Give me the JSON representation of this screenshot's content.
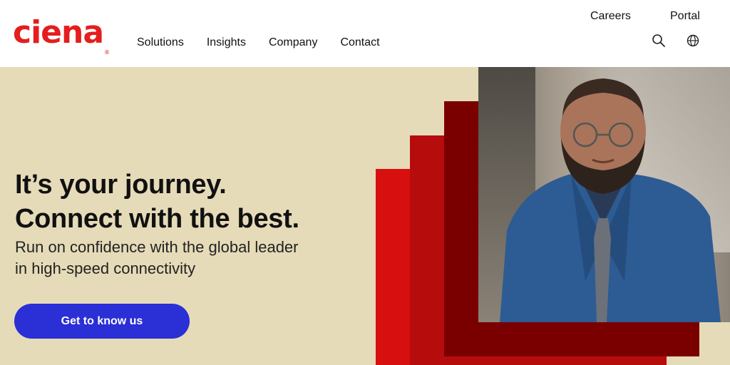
{
  "brand": {
    "name": "ciena",
    "color": "#e41e1e"
  },
  "header": {
    "nav": [
      "Solutions",
      "Insights",
      "Company",
      "Contact"
    ],
    "utility": {
      "careers": "Careers",
      "portal": "Portal"
    },
    "icons": {
      "search": "search-icon",
      "language": "globe-icon"
    }
  },
  "hero": {
    "headline_line1": "It’s your journey.",
    "headline_line2": "Connect with the best.",
    "subhead": "Run on confidence with the global leader in high-speed connectivity",
    "cta_label": "Get to know us",
    "colors": {
      "background": "#e6dbb8",
      "cta": "#2a2fd6",
      "bar_light": "#d80f0f",
      "bar_mid": "#b70c0c",
      "bar_dark": "#7a0000"
    }
  }
}
